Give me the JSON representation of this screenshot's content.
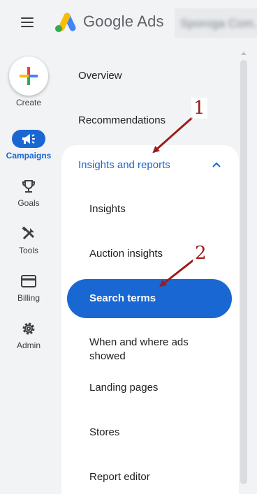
{
  "header": {
    "product_name": "Google Ads",
    "account_name": "Sporoga Com..."
  },
  "rail": {
    "create_label": "Create",
    "items": [
      {
        "label": "Campaigns",
        "icon": "megaphone-icon",
        "active": true
      },
      {
        "label": "Goals",
        "icon": "trophy-icon",
        "active": false
      },
      {
        "label": "Tools",
        "icon": "tools-icon",
        "active": false
      },
      {
        "label": "Billing",
        "icon": "credit-card-icon",
        "active": false
      },
      {
        "label": "Admin",
        "icon": "gear-icon",
        "active": false
      }
    ]
  },
  "nav": {
    "overview": "Overview",
    "recommendations": "Recommendations",
    "section": {
      "label": "Insights and reports",
      "expanded": true,
      "items": [
        {
          "label": "Insights",
          "selected": false
        },
        {
          "label": "Auction insights",
          "selected": false
        },
        {
          "label": "Search terms",
          "selected": true
        },
        {
          "label": "When and where ads showed",
          "selected": false
        },
        {
          "label": "Landing pages",
          "selected": false
        },
        {
          "label": "Stores",
          "selected": false
        },
        {
          "label": "Report editor",
          "selected": false
        }
      ]
    }
  },
  "annotations": [
    {
      "number": "1"
    },
    {
      "number": "2"
    }
  ],
  "colors": {
    "accent": "#1967d2",
    "background": "#f1f3f4",
    "annotation": "#9b1c1c"
  }
}
